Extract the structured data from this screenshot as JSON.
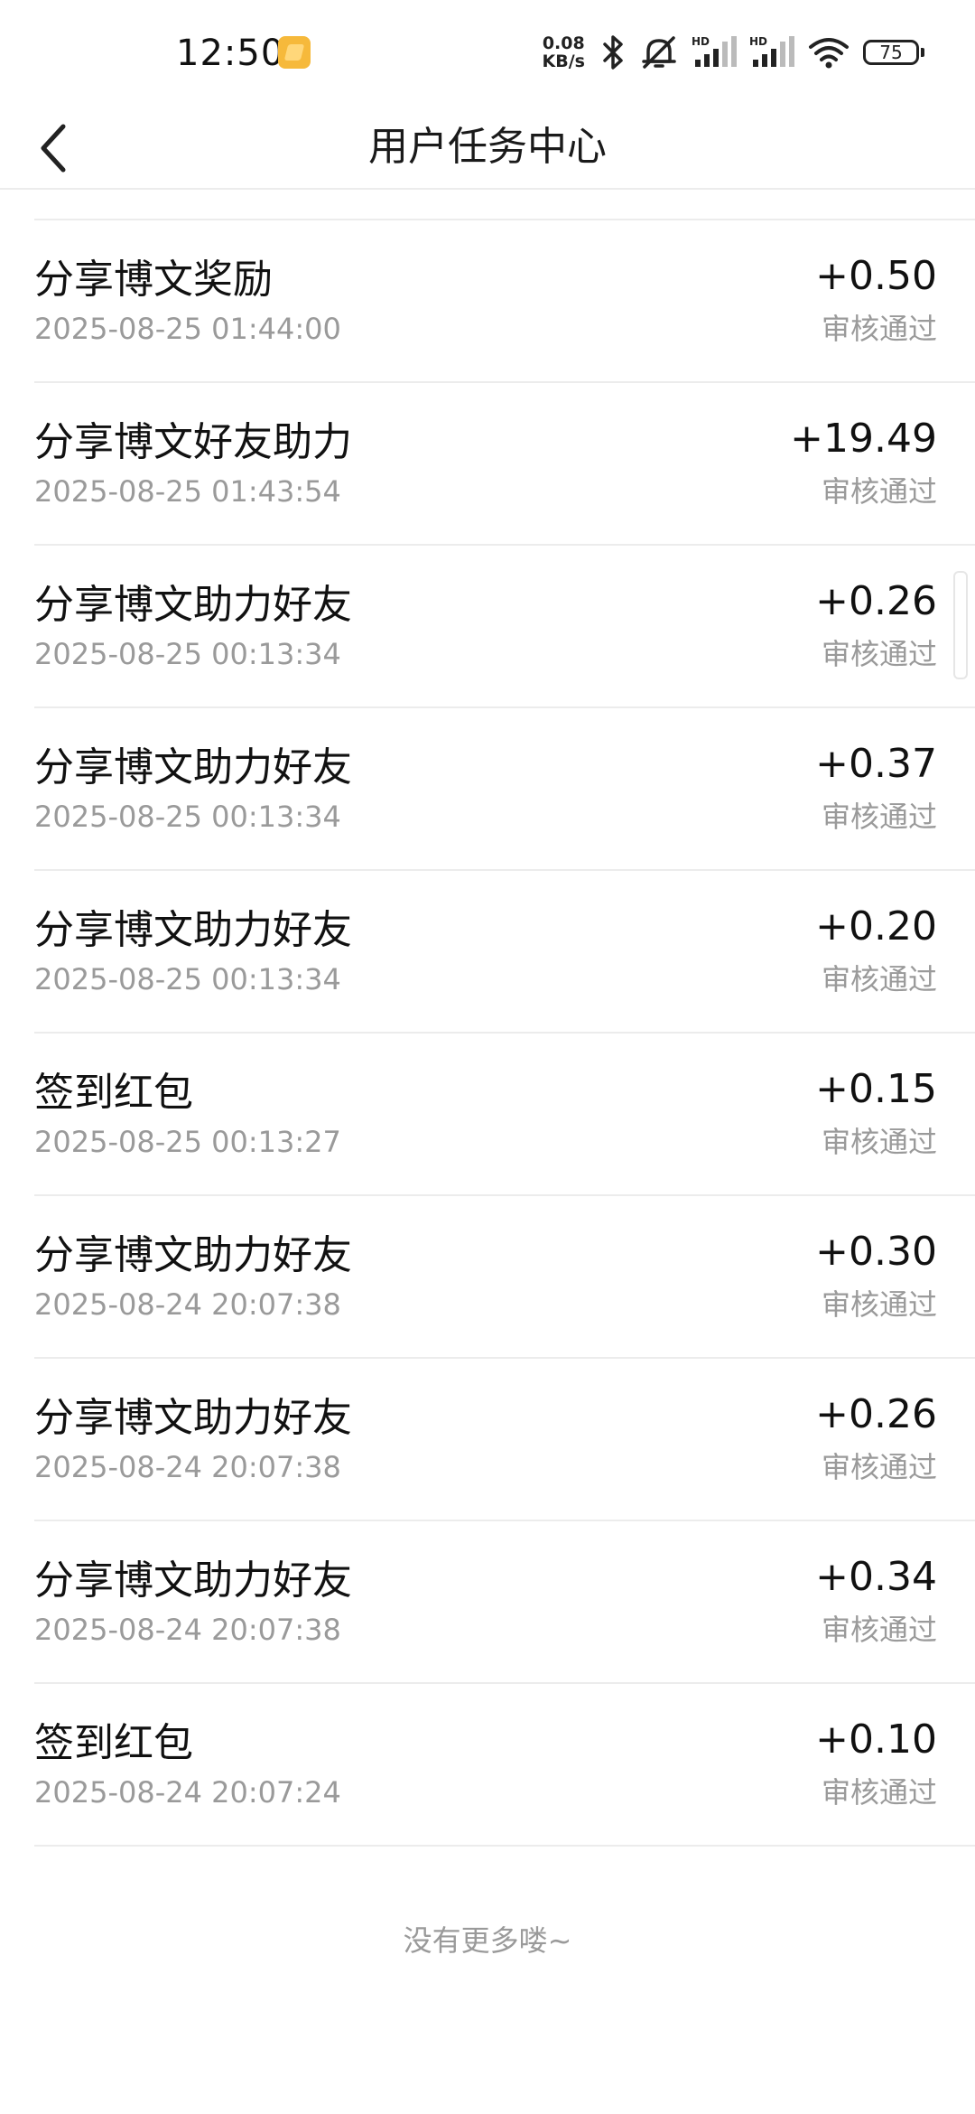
{
  "status_bar": {
    "time": "12:50",
    "net_speed_value": "0.08",
    "net_speed_unit": "KB/s",
    "battery_level": "75",
    "signal_label_1": "HD",
    "signal_label_2": "HD",
    "icons": [
      "notification-app-icon",
      "bluetooth-icon",
      "mute-icon",
      "signal-icon",
      "signal-icon",
      "wifi-icon",
      "battery-icon"
    ]
  },
  "header": {
    "title": "用户任务中心",
    "back_icon": "chevron-left-icon"
  },
  "records": [
    {
      "title": "分享博文奖励",
      "time": "2025-08-25 01:44:00",
      "amount": "+0.50",
      "status": "审核通过"
    },
    {
      "title": "分享博文好友助力",
      "time": "2025-08-25 01:43:54",
      "amount": "+19.49",
      "status": "审核通过"
    },
    {
      "title": "分享博文助力好友",
      "time": "2025-08-25 00:13:34",
      "amount": "+0.26",
      "status": "审核通过"
    },
    {
      "title": "分享博文助力好友",
      "time": "2025-08-25 00:13:34",
      "amount": "+0.37",
      "status": "审核通过"
    },
    {
      "title": "分享博文助力好友",
      "time": "2025-08-25 00:13:34",
      "amount": "+0.20",
      "status": "审核通过"
    },
    {
      "title": "签到红包",
      "time": "2025-08-25 00:13:27",
      "amount": "+0.15",
      "status": "审核通过"
    },
    {
      "title": "分享博文助力好友",
      "time": "2025-08-24 20:07:38",
      "amount": "+0.30",
      "status": "审核通过"
    },
    {
      "title": "分享博文助力好友",
      "time": "2025-08-24 20:07:38",
      "amount": "+0.26",
      "status": "审核通过"
    },
    {
      "title": "分享博文助力好友",
      "time": "2025-08-24 20:07:38",
      "amount": "+0.34",
      "status": "审核通过"
    },
    {
      "title": "签到红包",
      "time": "2025-08-24 20:07:24",
      "amount": "+0.10",
      "status": "审核通过"
    }
  ],
  "footer": {
    "end_message": "没有更多喽~"
  }
}
